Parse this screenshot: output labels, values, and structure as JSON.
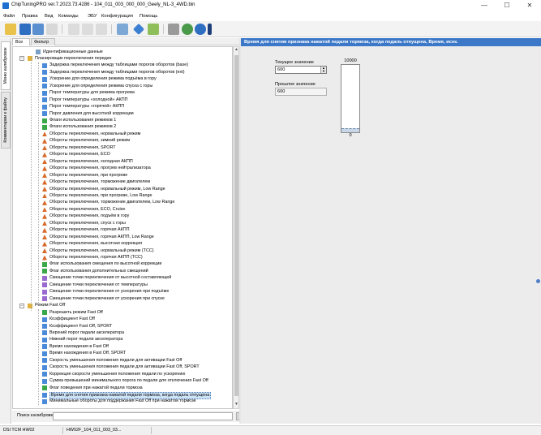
{
  "window": {
    "title": "ChipTuningPRO ver.7.2023.73.4286 - 104_011_003_000_000_Geely_NL-3_4WD.bin",
    "minimize": "—",
    "maximize": "☐",
    "close": "✕"
  },
  "menu": [
    "Файл",
    "Правка",
    "Вид",
    "Команды",
    "ЭБУ",
    "Конфигурация",
    "Помощь"
  ],
  "side_tabs": [
    "Меню калибровок",
    "Комментарии к файлу"
  ],
  "tree_tabs": [
    "Все",
    "Фильтр"
  ],
  "tree": [
    {
      "level": 2,
      "icon": "doc",
      "label": "Идентификационные данные"
    },
    {
      "level": 1,
      "icon": "folder",
      "toggle": "−",
      "label": "Планировщик переключения передач"
    },
    {
      "level": 3,
      "icon": "grid",
      "label": "Задержка переключения между таблицами порогов оборотов (base)"
    },
    {
      "level": 3,
      "icon": "grid",
      "label": "Задержка переключения между таблицами порогов оборотов (ext)"
    },
    {
      "level": 3,
      "icon": "grid",
      "label": "Ускорение для определения режима подъёма в гору"
    },
    {
      "level": 3,
      "icon": "grid",
      "label": "Ускорение для определения режима спуска с горы"
    },
    {
      "level": 3,
      "icon": "grid",
      "label": "Порог температуры для режима прогрева"
    },
    {
      "level": 3,
      "icon": "grid",
      "label": "Порог температуры «холодной» АКПП"
    },
    {
      "level": 3,
      "icon": "grid",
      "label": "Порог температуры «горячей» АКПП"
    },
    {
      "level": 3,
      "icon": "grid",
      "label": "Порог давления для высотной коррекции"
    },
    {
      "level": 3,
      "icon": "check",
      "label": "Флаги использования режимов 1"
    },
    {
      "level": 3,
      "icon": "check",
      "label": "Флаги использования режимов 2"
    },
    {
      "level": 3,
      "icon": "map",
      "label": "Обороты переключения, нормальный режим"
    },
    {
      "level": 3,
      "icon": "map",
      "label": "Обороты переключения, зимний режим"
    },
    {
      "level": 3,
      "icon": "map",
      "label": "Обороты переключения, SPORT"
    },
    {
      "level": 3,
      "icon": "map",
      "label": "Обороты переключения, ECO"
    },
    {
      "level": 3,
      "icon": "map",
      "label": "Обороты переключения, холодная АКПП"
    },
    {
      "level": 3,
      "icon": "map",
      "label": "Обороты переключения, прогрев нейтрализатора"
    },
    {
      "level": 3,
      "icon": "map",
      "label": "Обороты переключения, при прогреве"
    },
    {
      "level": 3,
      "icon": "map",
      "label": "Обороты переключения, торможение двигателем"
    },
    {
      "level": 3,
      "icon": "map",
      "label": "Обороты переключения, нормальный режим, Low Range"
    },
    {
      "level": 3,
      "icon": "map",
      "label": "Обороты переключения, при прогреве, Low Range"
    },
    {
      "level": 3,
      "icon": "map",
      "label": "Обороты переключения, торможение двигателем, Low Range"
    },
    {
      "level": 3,
      "icon": "map",
      "label": "Обороты переключения, ECO, Cruise"
    },
    {
      "level": 3,
      "icon": "map",
      "label": "Обороты переключения, подъём в гору"
    },
    {
      "level": 3,
      "icon": "map",
      "label": "Обороты переключения, спуск с горы"
    },
    {
      "level": 3,
      "icon": "map",
      "label": "Обороты переключения, горячая АКПП"
    },
    {
      "level": 3,
      "icon": "map",
      "label": "Обороты переключения, горячая АКПП, Low Range"
    },
    {
      "level": 3,
      "icon": "map",
      "label": "Обороты переключения, высотная коррекция"
    },
    {
      "level": 3,
      "icon": "map",
      "label": "Обороты переключения, нормальный режим (TCC)"
    },
    {
      "level": 3,
      "icon": "map",
      "label": "Обороты переключения, горячая АКПП (TCC)"
    },
    {
      "level": 3,
      "icon": "check",
      "label": "Флаг использования смещения по высотной коррекции"
    },
    {
      "level": 3,
      "icon": "check",
      "label": "Флаг использования дополнительных смещений"
    },
    {
      "level": 3,
      "icon": "bars",
      "label": "Смещение точки переключения от высотной составляющей"
    },
    {
      "level": 3,
      "icon": "bars",
      "label": "Смещение точки переключения от температуры"
    },
    {
      "level": 3,
      "icon": "bars",
      "label": "Смещение точки переключения от ускорения при подъёме"
    },
    {
      "level": 3,
      "icon": "bars",
      "label": "Смещение точки переключения от ускорения при спуске"
    },
    {
      "level": 1,
      "icon": "folder",
      "toggle": "−",
      "label": "Режим Fast Off"
    },
    {
      "level": 3,
      "icon": "check",
      "label": "Разрешить режим Fast Off"
    },
    {
      "level": 3,
      "icon": "grid",
      "label": "Коэффициент Fast Off"
    },
    {
      "level": 3,
      "icon": "grid",
      "label": "Коэффициент Fast Off, SPORT"
    },
    {
      "level": 3,
      "icon": "grid",
      "label": "Верхний порог педали акселератора"
    },
    {
      "level": 3,
      "icon": "grid",
      "label": "Нижний порог педали акселератора"
    },
    {
      "level": 3,
      "icon": "grid",
      "label": "Время нахождения в Fast Off"
    },
    {
      "level": 3,
      "icon": "grid",
      "label": "Время нахождения в Fast Off, SPORT"
    },
    {
      "level": 3,
      "icon": "grid",
      "label": "Скорость уменьшения положения педали для активации Fast Off"
    },
    {
      "level": 3,
      "icon": "grid",
      "label": "Скорость уменьшения положения педали для активации Fast Off, SPORT"
    },
    {
      "level": 3,
      "icon": "grid",
      "label": "Коррекция скорости уменьшения положения педали по ускорению"
    },
    {
      "level": 3,
      "icon": "grid",
      "label": "Сумма превышений минимального порога по педали для отключения Fast Off"
    },
    {
      "level": 3,
      "icon": "check",
      "label": "Флаг поведения при нажатой педали тормоза"
    },
    {
      "level": 3,
      "icon": "grid",
      "label": "Время для снятия признака нажатой педали тормоза, когда педаль отпущена",
      "selected": true
    },
    {
      "level": 3,
      "icon": "grid",
      "label": "Минимальные обороты для поддержания Fast Off при нажатом тормозе"
    }
  ],
  "search": {
    "label": "Поиск калибровки",
    "value": ""
  },
  "panel": {
    "header": "Время для снятия признака нажатой педали тормоза, когда педаль отпущена, Время, исек.",
    "current_label": "Текущее значение",
    "current_value": "600",
    "prev_label": "Прошлое значение",
    "prev_value": "600",
    "gauge_max": "10000",
    "gauge_min": "0",
    "gauge_fraction": 0.06
  },
  "status": {
    "left": "DSI TCM HW02",
    "file": "HW02F_104_011_003_03..."
  },
  "colors": {
    "accent": "#3c78c8",
    "selection": "#cfe3f7"
  }
}
